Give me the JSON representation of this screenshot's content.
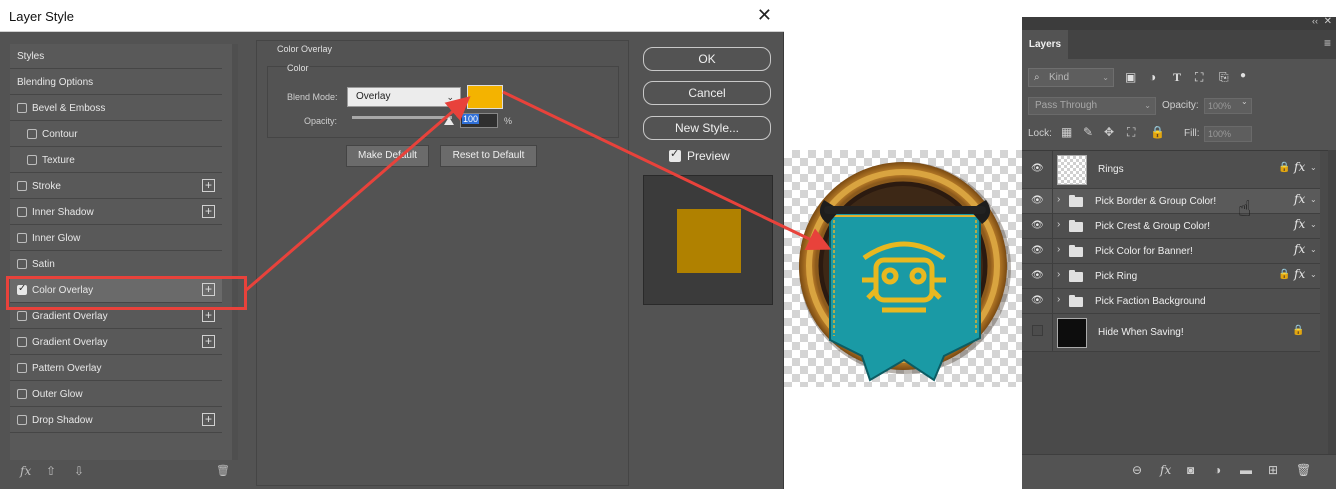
{
  "dialog": {
    "title": "Layer Style",
    "close_label": "✕",
    "styles": [
      {
        "label": "Styles",
        "checkbox": false,
        "plus": false,
        "indent": false
      },
      {
        "label": "Blending Options",
        "checkbox": false,
        "plus": false,
        "indent": false
      },
      {
        "label": "Bevel & Emboss",
        "checkbox": true,
        "checked": false,
        "plus": false,
        "indent": false
      },
      {
        "label": "Contour",
        "checkbox": true,
        "checked": false,
        "plus": false,
        "indent": true
      },
      {
        "label": "Texture",
        "checkbox": true,
        "checked": false,
        "plus": false,
        "indent": true
      },
      {
        "label": "Stroke",
        "checkbox": true,
        "checked": false,
        "plus": true,
        "indent": false
      },
      {
        "label": "Inner Shadow",
        "checkbox": true,
        "checked": false,
        "plus": true,
        "indent": false
      },
      {
        "label": "Inner Glow",
        "checkbox": true,
        "checked": false,
        "plus": false,
        "indent": false
      },
      {
        "label": "Satin",
        "checkbox": true,
        "checked": false,
        "plus": false,
        "indent": false
      },
      {
        "label": "Color Overlay",
        "checkbox": true,
        "checked": true,
        "plus": true,
        "indent": false
      },
      {
        "label": "Gradient Overlay",
        "checkbox": true,
        "checked": false,
        "plus": true,
        "indent": false
      },
      {
        "label": "Gradient Overlay",
        "checkbox": true,
        "checked": false,
        "plus": true,
        "indent": false
      },
      {
        "label": "Pattern Overlay",
        "checkbox": true,
        "checked": false,
        "plus": false,
        "indent": false
      },
      {
        "label": "Outer Glow",
        "checkbox": true,
        "checked": false,
        "plus": false,
        "indent": false
      },
      {
        "label": "Drop Shadow",
        "checkbox": true,
        "checked": false,
        "plus": true,
        "indent": false
      }
    ],
    "footer": {
      "fx": "fx",
      "up": "⇧",
      "down": "⇩",
      "trash": "🗑"
    },
    "color_overlay": {
      "group_title": "Color Overlay",
      "sub_title": "Color",
      "blend_mode_label": "Blend Mode:",
      "blend_mode_value": "Overlay",
      "swatch_color": "#f4b300",
      "opacity_label": "Opacity:",
      "opacity_value": "100",
      "opacity_unit": "%",
      "make_default": "Make Default",
      "reset_default": "Reset to Default"
    },
    "buttons": {
      "ok": "OK",
      "cancel": "Cancel",
      "new_style": "New Style..."
    },
    "preview_label": "Preview",
    "preview_color": "#b08100"
  },
  "layers_panel": {
    "tab": "Layers",
    "collapse": "‹‹",
    "close": "✕",
    "menu": "≡",
    "kind_placeholder": "Kind",
    "filter_icons": [
      "image-filter-icon",
      "adjustment-filter-icon",
      "type-filter-icon",
      "shape-filter-icon",
      "smart-object-filter-icon",
      "filter-toggle-icon"
    ],
    "blend_mode": "Pass Through",
    "opacity_label": "Opacity:",
    "opacity_value": "100%",
    "lock_label": "Lock:",
    "fill_label": "Fill:",
    "fill_value": "100%",
    "layers": [
      {
        "name": "Rings",
        "type": "layer",
        "visible": true,
        "lock": true,
        "fx": true,
        "thumb": "transparent"
      },
      {
        "name": "Pick Border & Group Color!",
        "type": "group",
        "visible": true,
        "lock": false,
        "fx": true
      },
      {
        "name": "Pick Crest & Group Color!",
        "type": "group",
        "visible": true,
        "lock": false,
        "fx": true
      },
      {
        "name": "Pick Color for Banner!",
        "type": "group",
        "visible": true,
        "lock": false,
        "fx": true
      },
      {
        "name": "Pick Ring",
        "type": "group",
        "visible": true,
        "lock": true,
        "fx": true
      },
      {
        "name": "Pick Faction Background",
        "type": "group",
        "visible": true,
        "lock": false,
        "fx": false
      },
      {
        "name": "Hide When Saving!",
        "type": "layer",
        "visible": false,
        "lock": true,
        "fx": false,
        "thumb": "black"
      }
    ],
    "fx_label": "fx",
    "footer_icons": [
      "link-icon",
      "fx-icon",
      "mask-icon",
      "adjustment-icon",
      "group-icon",
      "new-layer-icon",
      "delete-icon"
    ]
  },
  "colors": {
    "annotation": "#e8423b",
    "overlay": "#f4b300",
    "banner": "#1a9aa5"
  }
}
